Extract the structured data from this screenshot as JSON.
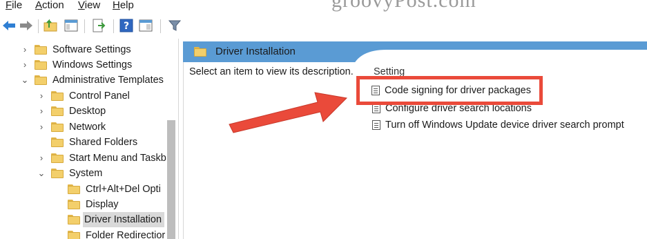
{
  "menubar": {
    "items": [
      {
        "label": "File",
        "underline": "F",
        "rest": "ile"
      },
      {
        "label": "Action",
        "underline": "A",
        "rest": "ction"
      },
      {
        "label": "View",
        "underline": "V",
        "rest": "iew"
      },
      {
        "label": "Help",
        "underline": "H",
        "rest": "elp"
      }
    ]
  },
  "watermark": "groovyPost.com",
  "toolbar": {
    "icons": [
      "back-arrow-icon",
      "forward-arrow-icon",
      "up-folder-icon",
      "show-hide-tree-icon",
      "export-list-icon",
      "help-icon",
      "properties-icon",
      "filter-icon"
    ]
  },
  "tree": {
    "items": [
      {
        "label": "Software Settings",
        "chevron": ">"
      },
      {
        "label": "Windows Settings",
        "chevron": ">"
      },
      {
        "label": "Administrative Templates",
        "chevron": "v"
      },
      {
        "label": "Control Panel",
        "chevron": ">"
      },
      {
        "label": "Desktop",
        "chevron": ">"
      },
      {
        "label": "Network",
        "chevron": ">"
      },
      {
        "label": "Shared Folders",
        "chevron": ""
      },
      {
        "label": "Start Menu and Taskb",
        "chevron": ">"
      },
      {
        "label": "System",
        "chevron": "v"
      },
      {
        "label": "Ctrl+Alt+Del Opti",
        "chevron": ""
      },
      {
        "label": "Display",
        "chevron": ""
      },
      {
        "label": "Driver Installation",
        "chevron": "",
        "selected": true
      },
      {
        "label": "Folder Redirectior",
        "chevron": ""
      }
    ]
  },
  "right": {
    "header_title": "Driver Installation",
    "description": "Select an item to view its description.",
    "column_header": "Setting",
    "settings": [
      "Code signing for driver packages",
      "Configure driver search locations",
      "Turn off Windows Update device driver search prompt"
    ]
  },
  "colors": {
    "header_blue": "#5a9bd4",
    "annotation_red": "#ea4a3a",
    "folder_yellow": "#f3cf6b"
  }
}
